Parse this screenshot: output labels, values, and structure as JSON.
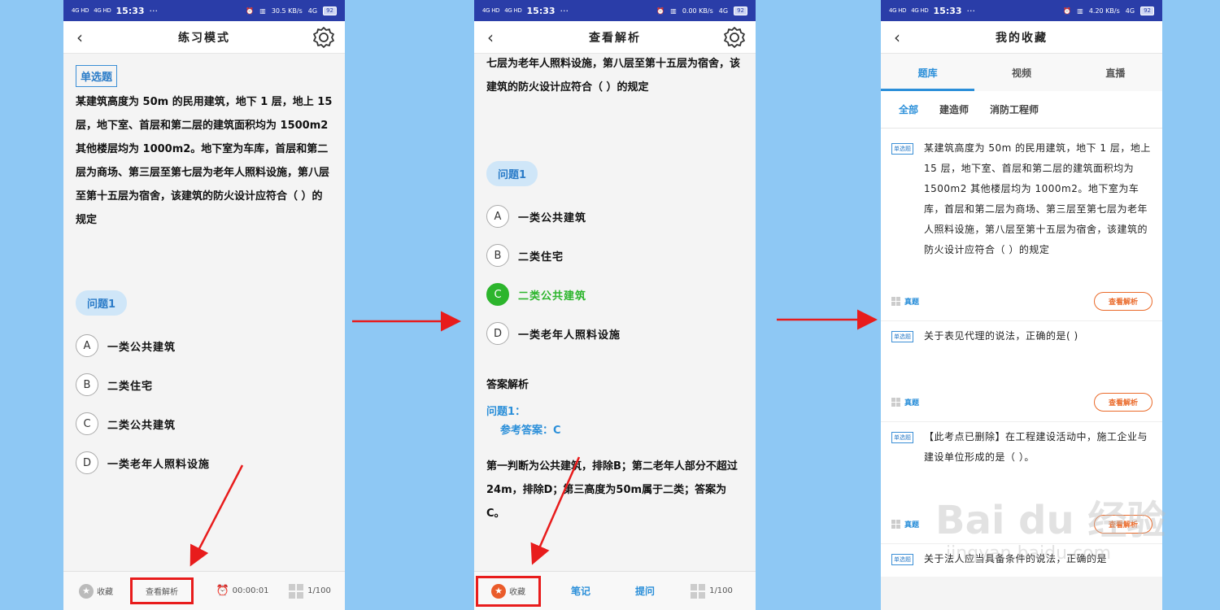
{
  "status": {
    "time": "15:33",
    "dots": "···",
    "net_left": "4G HD",
    "net_right": "4G",
    "speed_p1": "30.5 KB/s",
    "speed_p2": "0.00 KB/s",
    "speed_p3": "4.20 KB/s",
    "battery": "92"
  },
  "colors": {
    "accent": "#2b8fd9",
    "correct": "#2cb52c",
    "favorite": "#ea5b2a",
    "highlight": "#e81c1c",
    "background": "#8ec8f4"
  },
  "question": {
    "tag": "单选题",
    "text": "某建筑高度为 50m 的民用建筑，地下 1 层，地上 15 层，地下室、首层和第二层的建筑面积均为 1500m2 其他楼层均为 1000m2。地下室为车库，首层和第二层为商场、第三层至第七层为老年人照料设施，第八层至第十五层为宿舍，该建筑的防火设计应符合（ ）的规定",
    "text_tail": "七层为老年人照料设施，第八层至第十五层为宿舍，该建筑的防火设计应符合（ ）的规定",
    "question_label": "问题1",
    "options": [
      {
        "letter": "A",
        "text": "一类公共建筑"
      },
      {
        "letter": "B",
        "text": "二类住宅"
      },
      {
        "letter": "C",
        "text": "二类公共建筑"
      },
      {
        "letter": "D",
        "text": "一类老年人照料设施"
      }
    ]
  },
  "screen1": {
    "title": "练习模式",
    "bottom": {
      "favorite": "收藏",
      "view_analysis": "查看解析",
      "timer": "00:00:01",
      "page": "1/100"
    }
  },
  "screen2": {
    "title": "查看解析",
    "analysis_title": "答案解析",
    "answer_q": "问题1：",
    "answer_ref": "参考答案：C",
    "explanation": "第一判断为公共建筑，排除B；第二老年人部分不超过24m，排除D；第三高度为50m属于二类；答案为C。",
    "bottom": {
      "favorite": "收藏",
      "notes": "笔记",
      "ask": "提问",
      "page": "1/100"
    }
  },
  "screen3": {
    "title": "我的收藏",
    "tabs": [
      "题库",
      "视频",
      "直播"
    ],
    "subtabs": [
      "全部",
      "建造师",
      "消防工程师"
    ],
    "items": [
      {
        "tag": "单选题",
        "text": "某建筑高度为 50m 的民用建筑，地下 1 层，地上 15 层，地下室、首层和第二层的建筑面积均为 1500m2 其他楼层均为 1000m2。地下室为车库，首层和第二层为商场、第三层至第七层为老年人照料设施，第八层至第十五层为宿舍，该建筑的防火设计应符合（ ）的规定",
        "source": "真题",
        "button": "查看解析"
      },
      {
        "tag": "单选题",
        "text": "关于表见代理的说法，正确的是( )",
        "source": "真题",
        "button": "查看解析"
      },
      {
        "tag": "单选题",
        "text": "【此考点已删除】在工程建设活动中，施工企业与建设单位形成的是（ ）。",
        "source": "真题",
        "button": "查看解析"
      },
      {
        "tag": "单选题",
        "text": "关于法人应当具备条件的说法，正确的是",
        "source": "",
        "button": ""
      }
    ]
  },
  "watermark": {
    "main": "Bai du 经验",
    "sub": "jingyan.baidu.com"
  }
}
